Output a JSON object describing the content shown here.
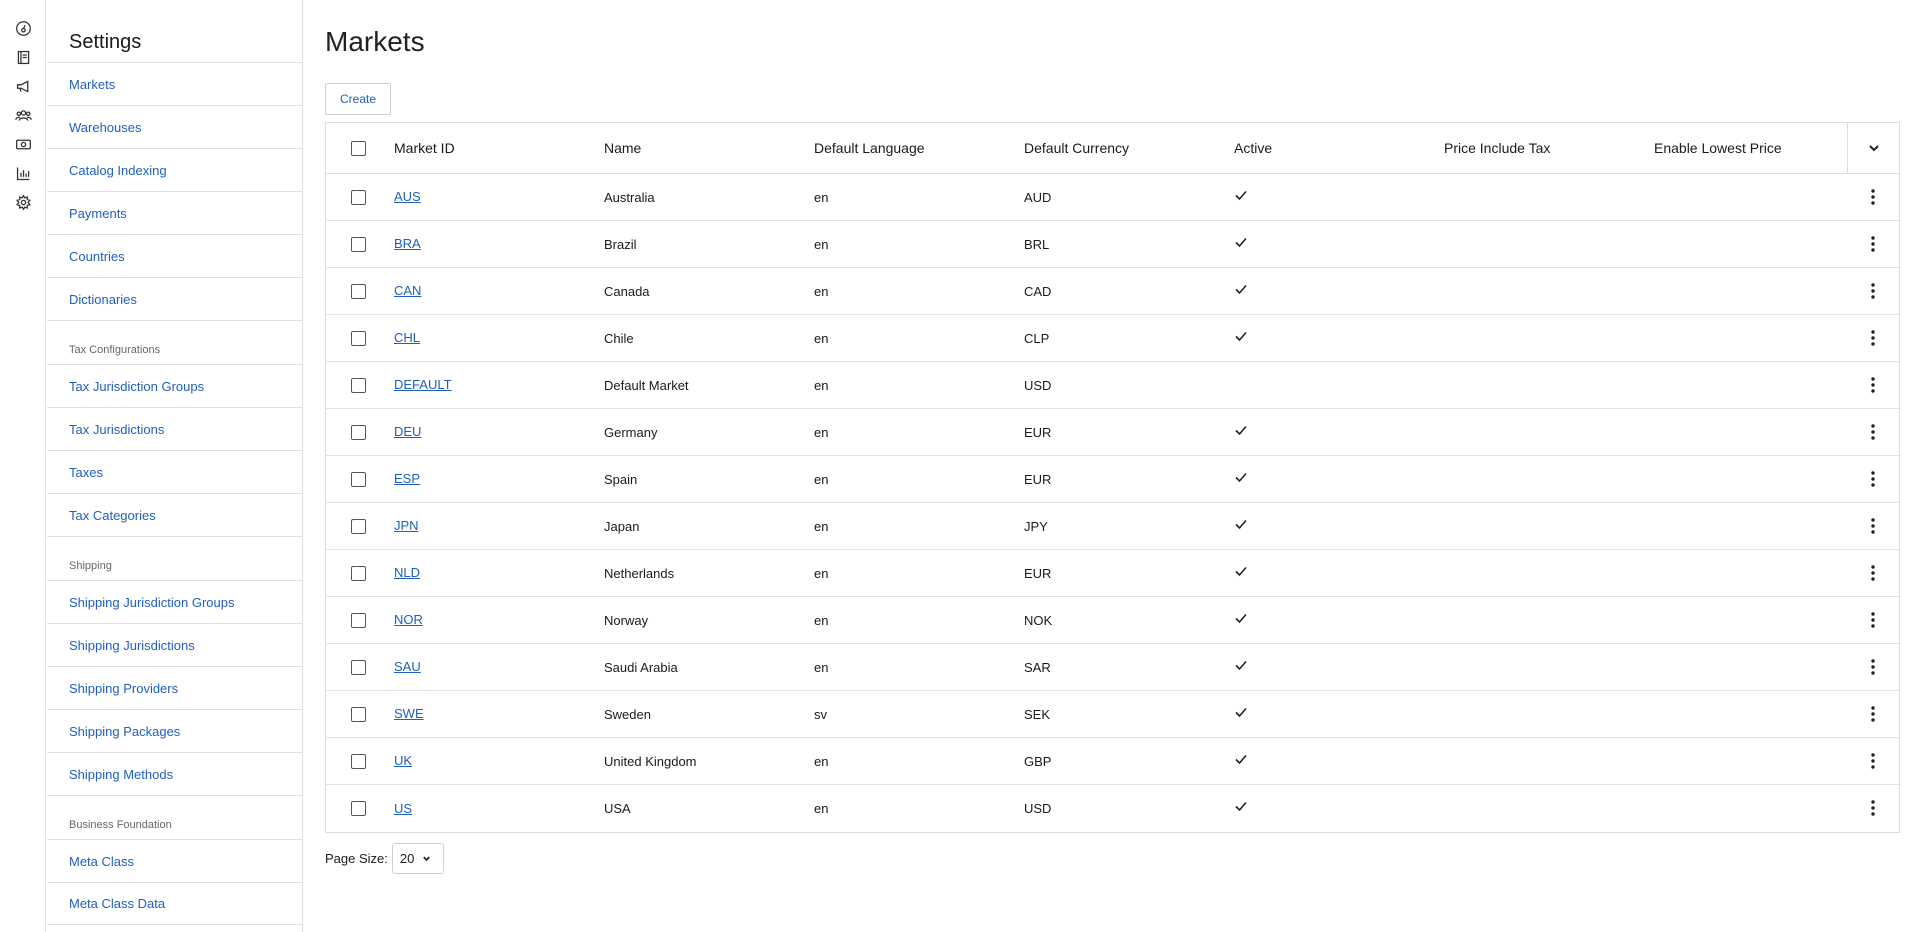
{
  "rail": {
    "icons": [
      "dashboard-icon",
      "catalog-icon",
      "marketing-icon",
      "customers-icon",
      "commerce-icon",
      "reports-icon",
      "settings-icon"
    ]
  },
  "sidebar": {
    "title": "Settings",
    "groups": [
      {
        "section": "",
        "items": [
          "Markets",
          "Warehouses",
          "Catalog Indexing",
          "Payments",
          "Countries",
          "Dictionaries"
        ]
      },
      {
        "section": "Tax Configurations",
        "items": [
          "Tax Jurisdiction Groups",
          "Tax Jurisdictions",
          "Taxes",
          "Tax Categories"
        ]
      },
      {
        "section": "Shipping",
        "items": [
          "Shipping Jurisdiction Groups",
          "Shipping Jurisdictions",
          "Shipping Providers",
          "Shipping Packages",
          "Shipping Methods"
        ]
      },
      {
        "section": "Business Foundation",
        "items": [
          "Meta Class",
          "Meta Class Data"
        ]
      }
    ]
  },
  "main": {
    "title": "Markets",
    "create_label": "Create",
    "columns": [
      "Market ID",
      "Name",
      "Default Language",
      "Default Currency",
      "Active",
      "Price Include Tax",
      "Enable Lowest Price"
    ],
    "rows": [
      {
        "id": "AUS",
        "name": "Australia",
        "lang": "en",
        "currency": "AUD",
        "active": true
      },
      {
        "id": "BRA",
        "name": "Brazil",
        "lang": "en",
        "currency": "BRL",
        "active": true
      },
      {
        "id": "CAN",
        "name": "Canada",
        "lang": "en",
        "currency": "CAD",
        "active": true
      },
      {
        "id": "CHL",
        "name": "Chile",
        "lang": "en",
        "currency": "CLP",
        "active": true
      },
      {
        "id": "DEFAULT",
        "name": "Default Market",
        "lang": "en",
        "currency": "USD",
        "active": false
      },
      {
        "id": "DEU",
        "name": "Germany",
        "lang": "en",
        "currency": "EUR",
        "active": true
      },
      {
        "id": "ESP",
        "name": "Spain",
        "lang": "en",
        "currency": "EUR",
        "active": true
      },
      {
        "id": "JPN",
        "name": "Japan",
        "lang": "en",
        "currency": "JPY",
        "active": true
      },
      {
        "id": "NLD",
        "name": "Netherlands",
        "lang": "en",
        "currency": "EUR",
        "active": true
      },
      {
        "id": "NOR",
        "name": "Norway",
        "lang": "en",
        "currency": "NOK",
        "active": true
      },
      {
        "id": "SAU",
        "name": "Saudi Arabia",
        "lang": "en",
        "currency": "SAR",
        "active": true
      },
      {
        "id": "SWE",
        "name": "Sweden",
        "lang": "sv",
        "currency": "SEK",
        "active": true
      },
      {
        "id": "UK",
        "name": "United Kingdom",
        "lang": "en",
        "currency": "GBP",
        "active": true
      },
      {
        "id": "US",
        "name": "USA",
        "lang": "en",
        "currency": "USD",
        "active": true
      }
    ],
    "pager": {
      "label": "Page Size:",
      "value": "20"
    }
  },
  "colors": {
    "link": "#1f5fbf",
    "border": "#dedede"
  }
}
